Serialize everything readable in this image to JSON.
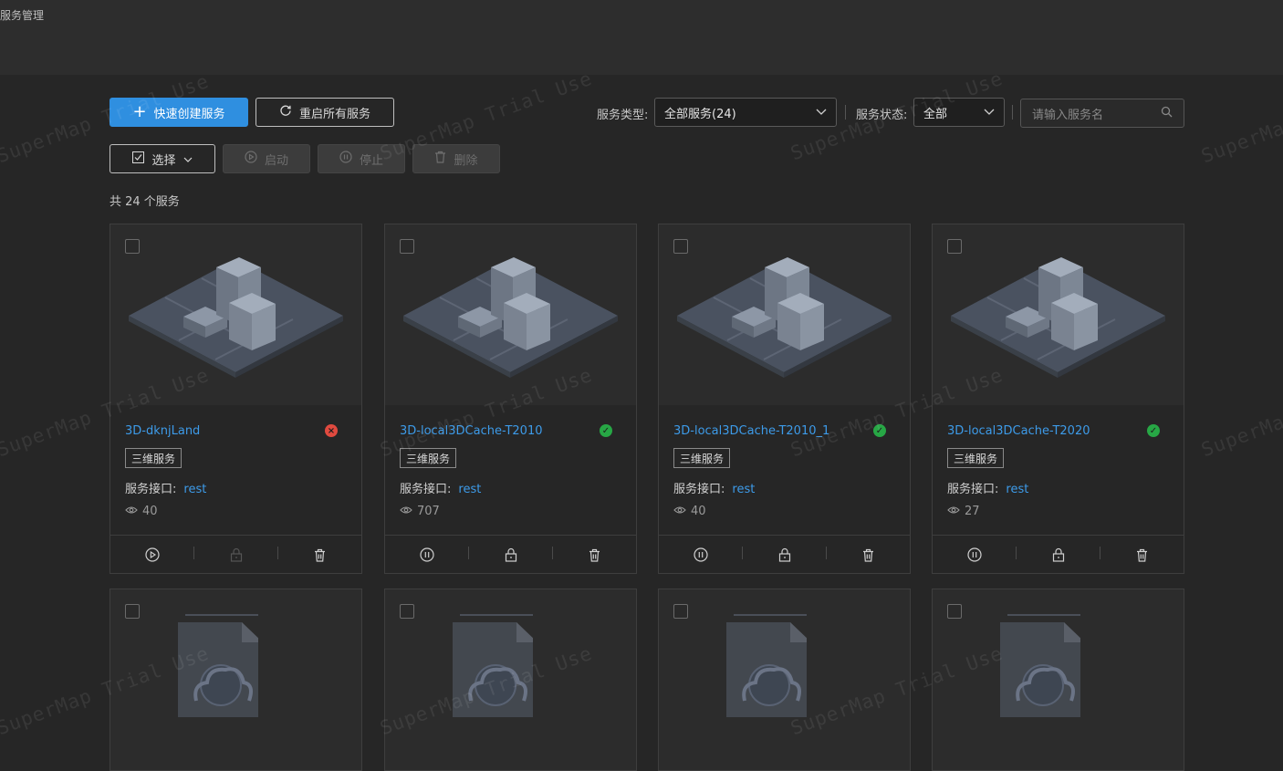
{
  "topbar": {
    "breadcrumb": "服务管理"
  },
  "toolbar": {
    "create_label": "快速创建服务",
    "restart_label": "重启所有服务",
    "type_label": "服务类型:",
    "type_value": "全部服务(24)",
    "status_label": "服务状态:",
    "status_value": "全部",
    "search_placeholder": "请输入服务名"
  },
  "actions": {
    "select_label": "选择",
    "start_label": "启动",
    "stop_label": "停止",
    "delete_label": "删除"
  },
  "count_text": "共 24 个服务",
  "watermark": "SuperMap Trial Use",
  "interface_label": "服务接口:",
  "cards": [
    {
      "title": "3D-dknjLand",
      "status": "error",
      "tag": "三维服务",
      "interface": "rest",
      "views": "40",
      "running": false
    },
    {
      "title": "3D-local3DCache-T2010",
      "status": "ok",
      "tag": "三维服务",
      "interface": "rest",
      "views": "707",
      "running": true
    },
    {
      "title": "3D-local3DCache-T2010_1",
      "status": "ok",
      "tag": "三维服务",
      "interface": "rest",
      "views": "40",
      "running": true
    },
    {
      "title": "3D-local3DCache-T2020",
      "status": "ok",
      "tag": "三维服务",
      "interface": "rest",
      "views": "27",
      "running": true
    }
  ],
  "colors": {
    "accent": "#2f8fe0",
    "link": "#3d9be9",
    "ok": "#27a745",
    "error": "#e04a3f"
  }
}
